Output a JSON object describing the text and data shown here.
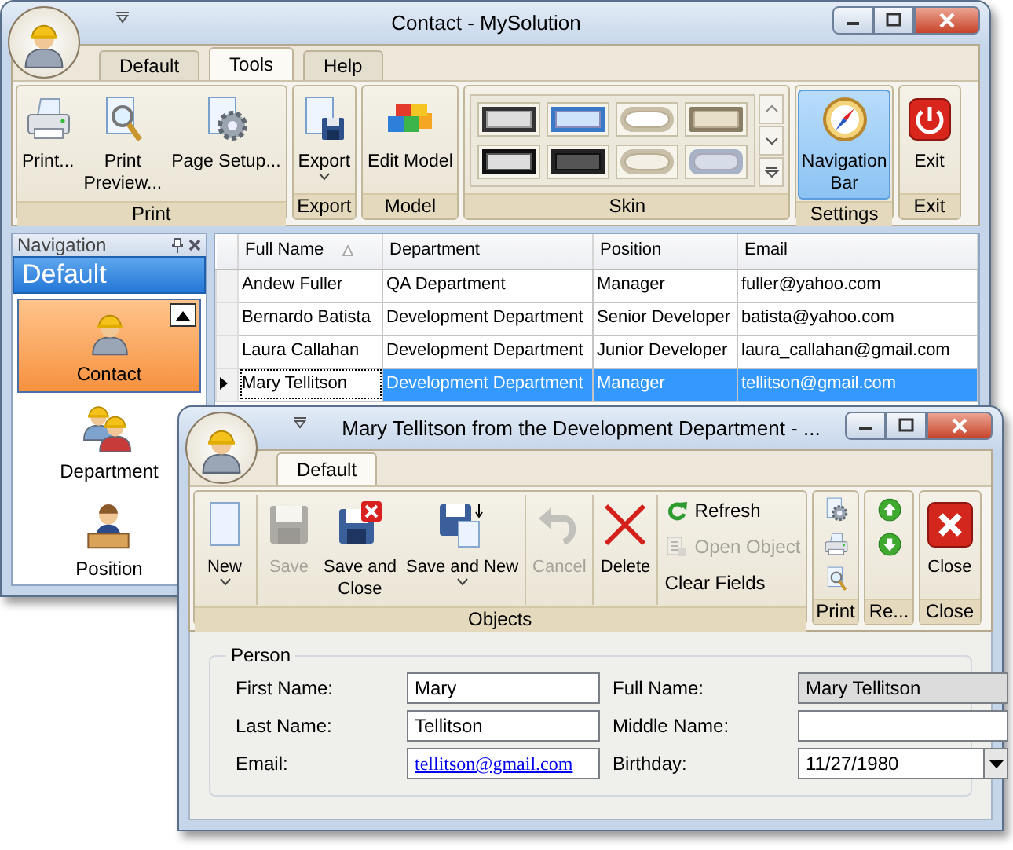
{
  "main_window": {
    "title": "Contact - MySolution",
    "tabs": [
      {
        "label": "Default",
        "selected": false
      },
      {
        "label": "Tools",
        "selected": true
      },
      {
        "label": "Help",
        "selected": false
      }
    ],
    "ribbon_groups": [
      {
        "label": "Print",
        "kind": "buttons",
        "sections": [
          {
            "kind": "large",
            "items": [
              {
                "label": "Print...",
                "kind": "print"
              },
              {
                "label": "Print\nPreview...",
                "kind": "preview"
              },
              {
                "label": "Page Setup...",
                "kind": "page-setup"
              }
            ]
          }
        ]
      },
      {
        "label": "Export",
        "kind": "buttons",
        "sections": [
          {
            "kind": "large",
            "items": [
              {
                "label": "Export",
                "kind": "export",
                "dropdown": true
              }
            ]
          }
        ]
      },
      {
        "label": "Model",
        "kind": "buttons",
        "sections": [
          {
            "kind": "large",
            "items": [
              {
                "label": "Edit Model",
                "kind": "edit-model"
              }
            ]
          }
        ]
      },
      {
        "label": "Skin",
        "kind": "gallery"
      },
      {
        "label": "Settings",
        "kind": "buttons",
        "sections": [
          {
            "kind": "large",
            "items": [
              {
                "label": "Navigation\nBar",
                "kind": "navigation-bar",
                "checked": true
              }
            ]
          }
        ]
      },
      {
        "label": "Exit",
        "kind": "buttons",
        "sections": [
          {
            "kind": "large",
            "items": [
              {
                "label": "Exit",
                "kind": "exit"
              }
            ]
          }
        ]
      }
    ],
    "navigation": {
      "title": "Navigation",
      "group": "Default",
      "items": [
        {
          "label": "Contact",
          "kind": "contact",
          "selected": true
        },
        {
          "label": "Department",
          "kind": "department",
          "selected": false
        },
        {
          "label": "Position",
          "kind": "position",
          "selected": false
        }
      ]
    },
    "grid": {
      "columns": [
        {
          "label": "Full Name",
          "sorted": true
        },
        {
          "label": "Department",
          "sorted": false
        },
        {
          "label": "Position",
          "sorted": false
        },
        {
          "label": "Email",
          "sorted": false
        }
      ],
      "rows": [
        {
          "cells": [
            "Andew Fuller",
            "QA Department",
            "Manager",
            "fuller@yahoo.com"
          ],
          "selected": false
        },
        {
          "cells": [
            "Bernardo Batista",
            "Development Department",
            "Senior Developer",
            "batista@yahoo.com"
          ],
          "selected": false
        },
        {
          "cells": [
            "Laura Callahan",
            "Development Department",
            "Junior Developer",
            "laura_callahan@gmail.com"
          ],
          "selected": false
        },
        {
          "cells": [
            "Mary Tellitson",
            "Development Department",
            "Manager",
            "tellitson@gmail.com"
          ],
          "selected": true
        }
      ]
    }
  },
  "detail_window": {
    "title": "Mary Tellitson from the Development Department - ...",
    "tabs": [
      {
        "label": "Default",
        "selected": true
      }
    ],
    "ribbon_groups": [
      {
        "label": "Objects",
        "kind": "buttons",
        "sections": [
          {
            "kind": "large",
            "items": [
              {
                "label": "New",
                "kind": "new",
                "dropdown": true,
                "disabled": false
              }
            ]
          },
          {
            "kind": "large",
            "items": [
              {
                "label": "Save",
                "kind": "save",
                "dropdown": false,
                "disabled": true
              },
              {
                "label": "Save and\nClose",
                "kind": "save-close",
                "dropdown": false,
                "disabled": false
              },
              {
                "label": "Save and New",
                "kind": "save-new",
                "dropdown": true,
                "disabled": false
              }
            ]
          },
          {
            "kind": "large",
            "items": [
              {
                "label": "Cancel",
                "kind": "cancel",
                "dropdown": false,
                "disabled": true
              }
            ]
          },
          {
            "kind": "large",
            "items": [
              {
                "label": "Delete",
                "kind": "delete",
                "dropdown": false,
                "disabled": false
              }
            ]
          },
          {
            "kind": "small",
            "items": [
              {
                "label": "Refresh",
                "kind": "refresh",
                "disabled": false
              },
              {
                "label": "Open Object",
                "kind": "open-object",
                "disabled": true
              },
              {
                "label": "Clear Fields",
                "kind": "clear-fields",
                "disabled": false
              }
            ]
          }
        ]
      },
      {
        "label": "Print",
        "kind": "buttons",
        "sections": [
          {
            "kind": "icons",
            "items": [
              {
                "kind": "page-setup"
              },
              {
                "kind": "print"
              },
              {
                "kind": "preview"
              }
            ]
          }
        ]
      },
      {
        "label": "Re...",
        "kind": "buttons",
        "sections": [
          {
            "kind": "icons",
            "items": [
              {
                "kind": "previous"
              },
              {
                "kind": "next"
              }
            ]
          }
        ]
      },
      {
        "label": "Close",
        "kind": "buttons",
        "sections": [
          {
            "kind": "large",
            "items": [
              {
                "label": "Close",
                "kind": "close"
              }
            ]
          }
        ]
      }
    ],
    "form": {
      "title": "Person",
      "fields": [
        {
          "label": "First Name:",
          "value": "Mary",
          "kind": "text"
        },
        {
          "label": "Full Name:",
          "value": "Mary Tellitson",
          "kind": "readonly"
        },
        {
          "label": "Last Name:",
          "value": "Tellitson",
          "kind": "text"
        },
        {
          "label": "Middle Name:",
          "kind": "text"
        },
        {
          "label": "Email:",
          "value": "tellitson@gmail.com",
          "kind": "link"
        },
        {
          "label": "Birthday:",
          "value": "11/27/1980",
          "kind": "date"
        }
      ]
    }
  }
}
